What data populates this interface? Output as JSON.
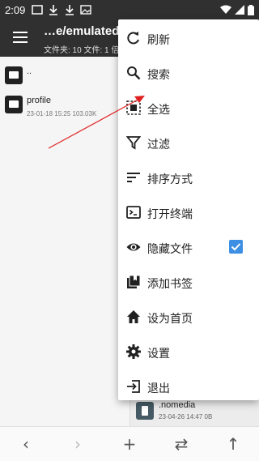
{
  "status_bar": {
    "time": "2:09"
  },
  "toolbar": {
    "title": "…e/emulated",
    "subtitle": "文件夹: 10  文件: 1  倍"
  },
  "left_pane": {
    "rows": [
      {
        "name": "..",
        "meta": ""
      },
      {
        "name": "profile",
        "meta": "23-01-18 15:25  103.03K"
      }
    ]
  },
  "right_pane": {
    "file": {
      "name": ".nomedia",
      "meta": "23-04-26 14:47  0B"
    }
  },
  "menu": {
    "items": [
      {
        "label": "刷新",
        "icon": "refresh-icon"
      },
      {
        "label": "搜索",
        "icon": "search-icon"
      },
      {
        "label": "全选",
        "icon": "select-all-icon"
      },
      {
        "label": "过滤",
        "icon": "filter-icon"
      },
      {
        "label": "排序方式",
        "icon": "sort-icon"
      },
      {
        "label": "打开终端",
        "icon": "terminal-icon"
      },
      {
        "label": "隐藏文件",
        "icon": "eye-icon",
        "checked": true
      },
      {
        "label": "添加书签",
        "icon": "bookmarks-icon"
      },
      {
        "label": "设为首页",
        "icon": "home-icon"
      },
      {
        "label": "设置",
        "icon": "gear-icon"
      },
      {
        "label": "退出",
        "icon": "exit-icon"
      }
    ]
  },
  "bottom_bar": {
    "buttons": [
      {
        "icon": "back-arrow-icon",
        "glyph": "‹"
      },
      {
        "icon": "forward-arrow-icon",
        "glyph": "›"
      },
      {
        "icon": "add-icon",
        "glyph": "+"
      },
      {
        "icon": "swap-icon",
        "glyph": "⇄"
      },
      {
        "icon": "up-arrow-icon",
        "glyph": "↑"
      }
    ]
  },
  "colors": {
    "toolbar_bg": "#303030",
    "checkbox": "#3d8fe3",
    "annotation_arrow": "#e02020"
  }
}
